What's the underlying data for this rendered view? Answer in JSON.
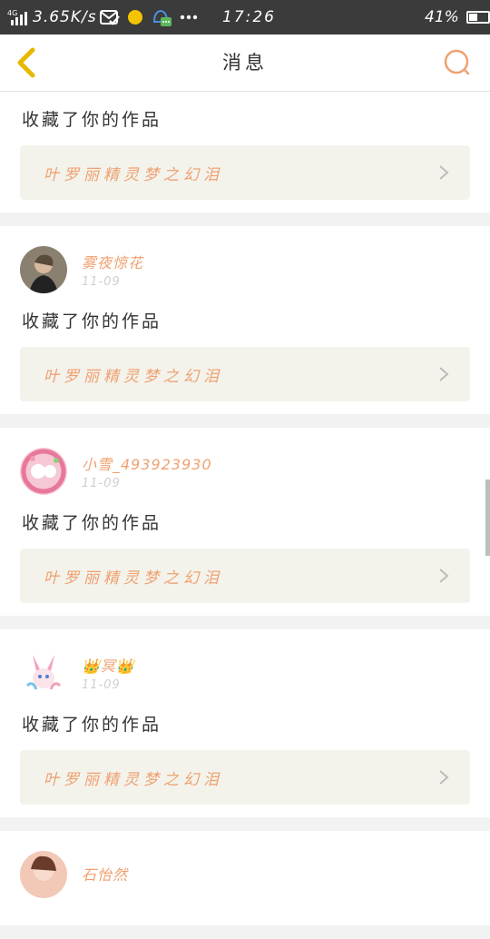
{
  "status_bar": {
    "signal": "4G",
    "net_speed": "3.65K/s",
    "time": "17:26",
    "battery": "41%",
    "battery_level": 0.41
  },
  "nav": {
    "title": "消息"
  },
  "notifications": [
    {
      "user": "",
      "date": "",
      "action": "收藏了你的作品",
      "work": "叶罗丽精灵梦之幻泪"
    },
    {
      "user": "雾夜惊花",
      "date": "11-09",
      "action": "收藏了你的作品",
      "work": "叶罗丽精灵梦之幻泪"
    },
    {
      "user": "小雪_493923930",
      "date": "11-09",
      "action": "收藏了你的作品",
      "work": "叶罗丽精灵梦之幻泪"
    },
    {
      "user": "👑冥👑",
      "date": "11-09",
      "action": "收藏了你的作品",
      "work": "叶罗丽精灵梦之幻泪"
    },
    {
      "user": "石怡然",
      "date": "",
      "action": "",
      "work": ""
    }
  ],
  "colors": {
    "accent": "#f0a070",
    "back_arrow": "#e8b800",
    "status_bg": "#3b3b3b"
  }
}
